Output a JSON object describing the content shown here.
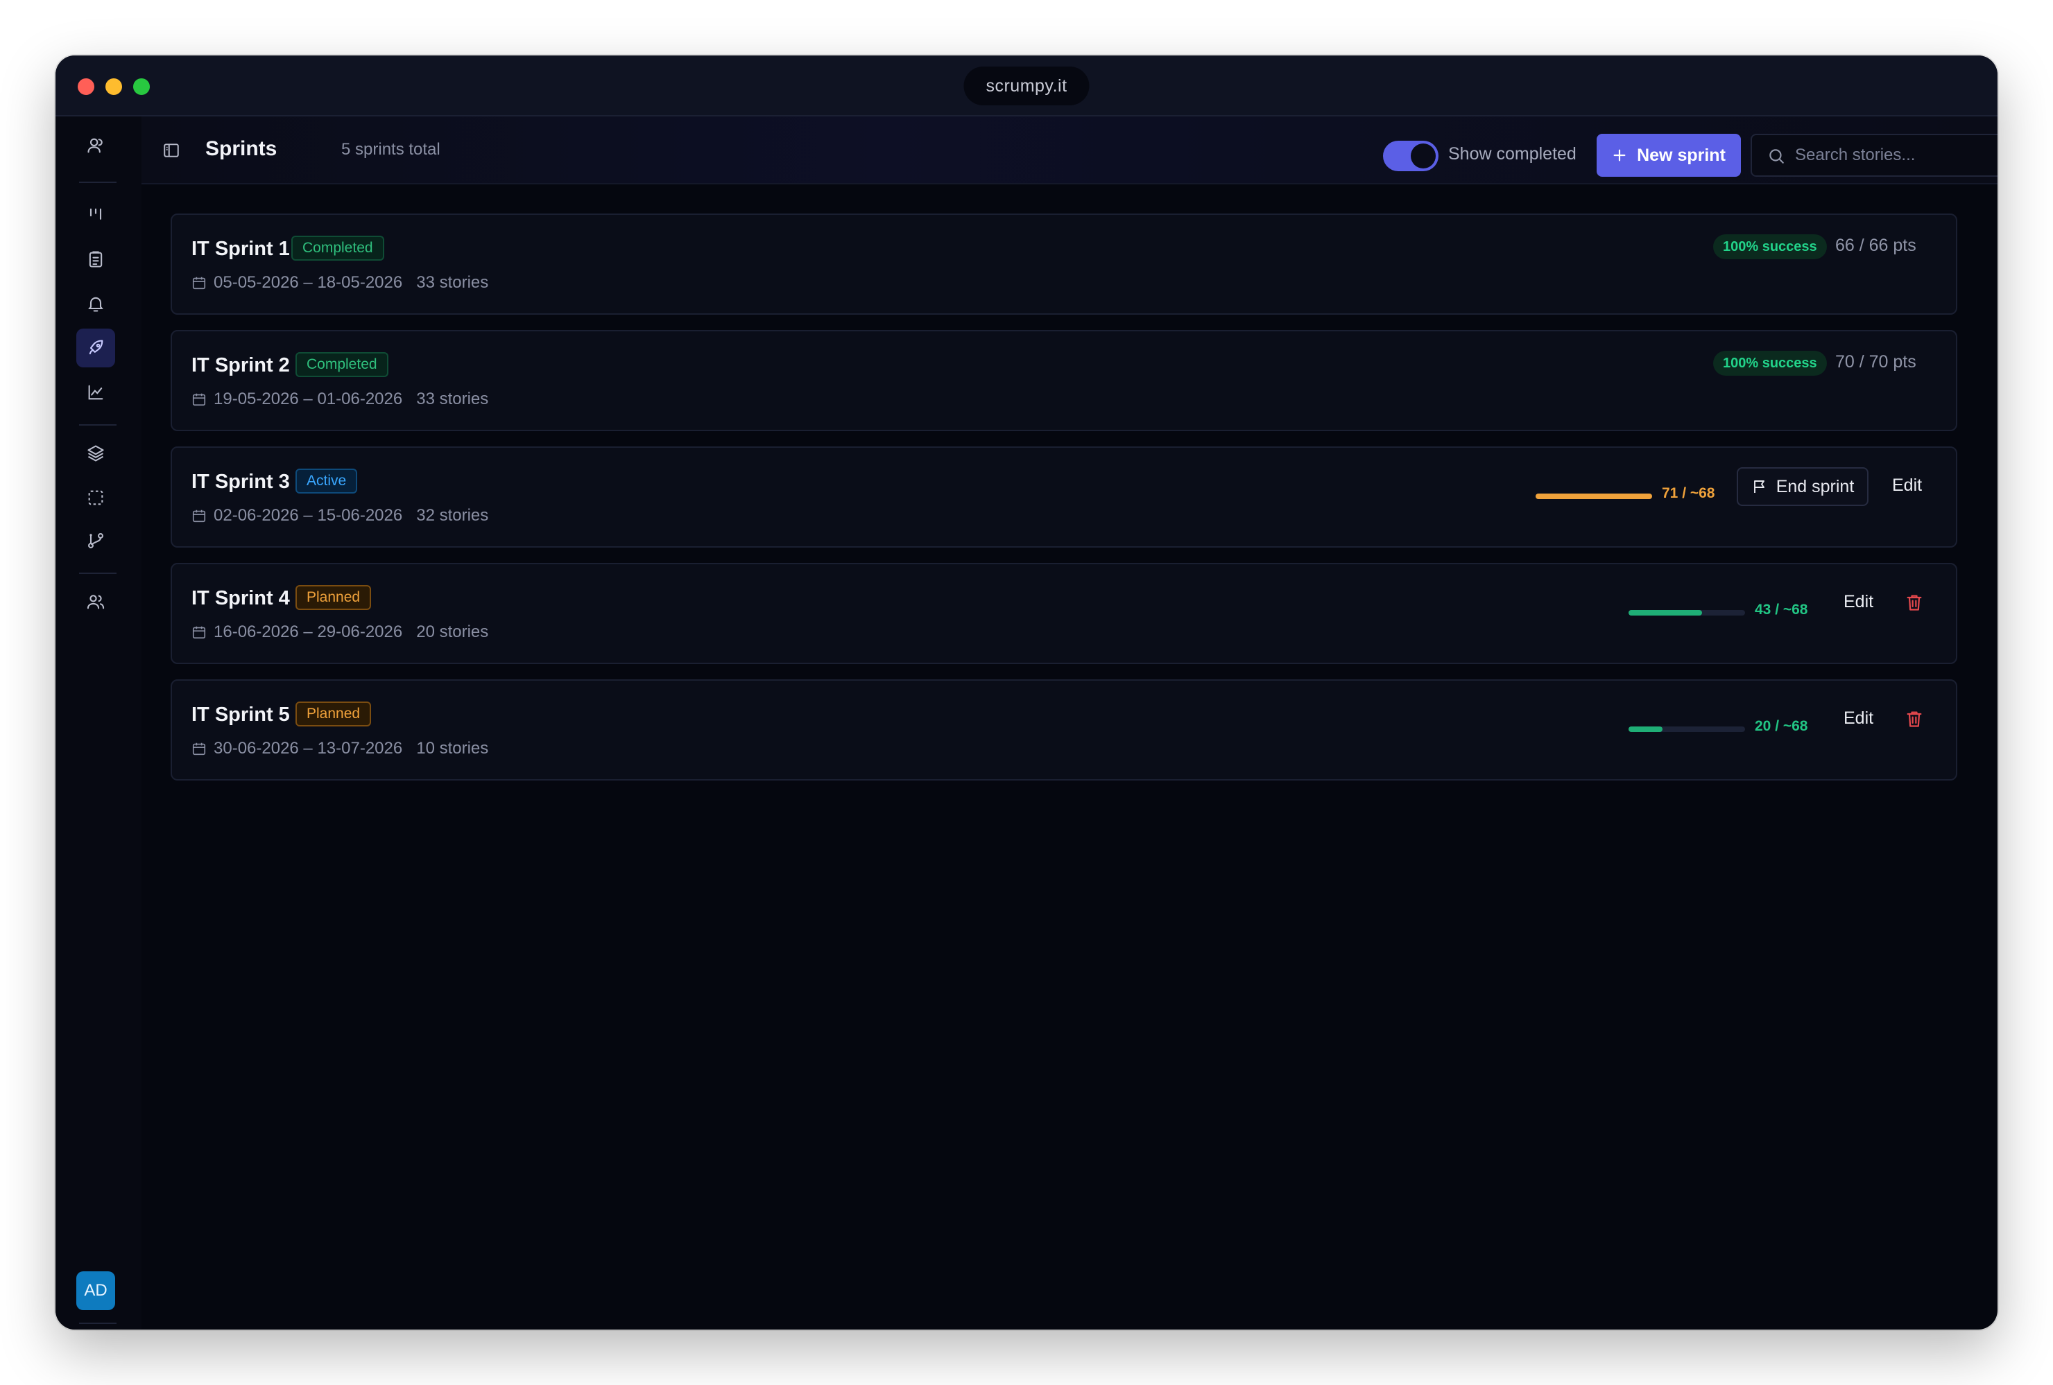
{
  "window": {
    "url": "scrumpy.it"
  },
  "sidebar": {
    "avatar": "AD"
  },
  "header": {
    "title": "Sprints",
    "subtitle": "5 sprints total",
    "toggle_label": "Show completed",
    "toggle_on": true,
    "new_button": "New sprint",
    "search_placeholder": "Search stories..."
  },
  "colors": {
    "accent": "#5b5fe6",
    "success": "#22d38a",
    "warning": "#f0a23b",
    "danger": "#e5484d"
  },
  "sprints": [
    {
      "name": "IT Sprint 1",
      "status": "Completed",
      "dates": "05-05-2026 – 18-05-2026",
      "stories": "33 stories",
      "success": "100% success",
      "pts": "66 / 66 pts"
    },
    {
      "name": "IT Sprint 2",
      "status": "Completed",
      "dates": "19-05-2026 – 01-06-2026",
      "stories": "33 stories",
      "success": "100% success",
      "pts": "70 / 70 pts"
    },
    {
      "name": "IT Sprint 3",
      "status": "Active",
      "dates": "02-06-2026 – 15-06-2026",
      "stories": "32 stories",
      "progress_text": "71 / ~68",
      "progress": 1.0,
      "end_label": "End sprint",
      "edit_label": "Edit"
    },
    {
      "name": "IT Sprint 4",
      "status": "Planned",
      "dates": "16-06-2026 – 29-06-2026",
      "stories": "20 stories",
      "progress_text": "43 / ~68",
      "progress": 0.63,
      "edit_label": "Edit"
    },
    {
      "name": "IT Sprint 5",
      "status": "Planned",
      "dates": "30-06-2026 – 13-07-2026",
      "stories": "10 stories",
      "progress_text": "20 / ~68",
      "progress": 0.29,
      "edit_label": "Edit"
    }
  ],
  "icons": [
    "users-icon",
    "kanban-icon",
    "clipboard-icon",
    "bell-icon",
    "rocket-icon",
    "chart-line-icon",
    "layers-icon",
    "select-dashed-icon",
    "git-branch-icon",
    "team-icon",
    "headset-icon"
  ]
}
